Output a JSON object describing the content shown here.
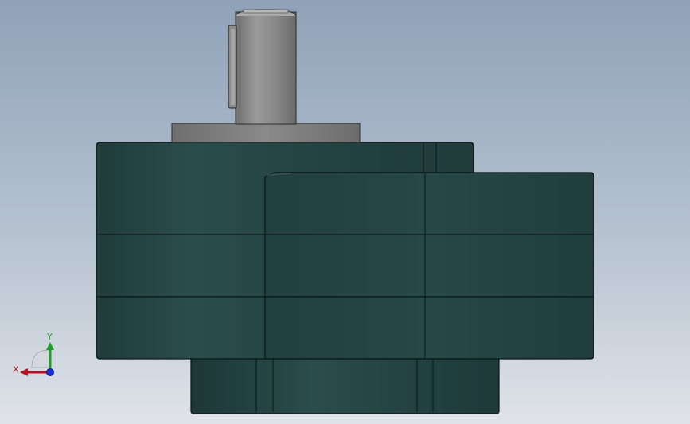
{
  "viewport": {
    "background_top": "#8fa2b8",
    "background_bottom": "#dfe3e8"
  },
  "model": {
    "housing_color": "#254544",
    "shaft_color": "#8c8c8c",
    "edge_color": "#0a1514"
  },
  "triad": {
    "x_label": "X",
    "y_label": "Y",
    "x_color": "#b0141e",
    "y_color": "#18a028",
    "z_color": "#1a2fd0"
  }
}
